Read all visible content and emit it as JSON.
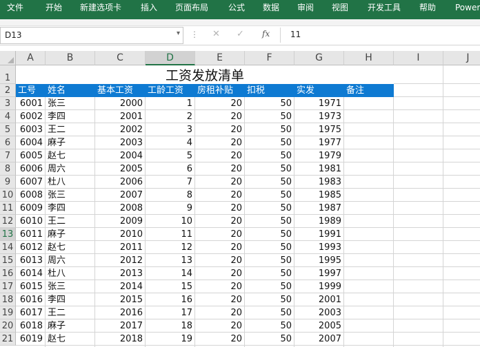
{
  "ribbon": {
    "bg": "#217346",
    "tabs": [
      "文件",
      "开始",
      "新建选项卡",
      "插入",
      "页面布局",
      "公式",
      "数据",
      "审阅",
      "视图",
      "开发工具",
      "帮助",
      "Power"
    ]
  },
  "formula_bar": {
    "name_box": "D13",
    "value": "11",
    "fx": "fx"
  },
  "columns": [
    "A",
    "B",
    "C",
    "D",
    "E",
    "F",
    "G",
    "H",
    "I",
    "J"
  ],
  "selected_column": "D",
  "selected_row": 13,
  "row_numbers": [
    "1",
    "2",
    "3",
    "4",
    "5",
    "6",
    "7",
    "8",
    "9",
    "10",
    "11",
    "12",
    "13",
    "14",
    "15",
    "16",
    "17",
    "18",
    "19",
    "20",
    "21"
  ],
  "sheet": {
    "title": "工资发放清单",
    "header_fill": "#0e7ad2",
    "headers": [
      "工号",
      "姓名",
      "基本工资",
      "工龄工资",
      "房租补贴",
      "扣税",
      "实发",
      "备注"
    ],
    "rows": [
      [
        "6001",
        "张三",
        "2000",
        "1",
        "20",
        "50",
        "1971"
      ],
      [
        "6002",
        "李四",
        "2001",
        "2",
        "20",
        "50",
        "1973"
      ],
      [
        "6003",
        "王二",
        "2002",
        "3",
        "20",
        "50",
        "1975"
      ],
      [
        "6004",
        "麻子",
        "2003",
        "4",
        "20",
        "50",
        "1977"
      ],
      [
        "6005",
        "赵七",
        "2004",
        "5",
        "20",
        "50",
        "1979"
      ],
      [
        "6006",
        "周六",
        "2005",
        "6",
        "20",
        "50",
        "1981"
      ],
      [
        "6007",
        "杜八",
        "2006",
        "7",
        "20",
        "50",
        "1983"
      ],
      [
        "6008",
        "张三",
        "2007",
        "8",
        "20",
        "50",
        "1985"
      ],
      [
        "6009",
        "李四",
        "2008",
        "9",
        "20",
        "50",
        "1987"
      ],
      [
        "6010",
        "王二",
        "2009",
        "10",
        "20",
        "50",
        "1989"
      ],
      [
        "6011",
        "麻子",
        "2010",
        "11",
        "20",
        "50",
        "1991"
      ],
      [
        "6012",
        "赵七",
        "2011",
        "12",
        "20",
        "50",
        "1993"
      ],
      [
        "6013",
        "周六",
        "2012",
        "13",
        "20",
        "50",
        "1995"
      ],
      [
        "6014",
        "杜八",
        "2013",
        "14",
        "20",
        "50",
        "1997"
      ],
      [
        "6015",
        "张三",
        "2014",
        "15",
        "20",
        "50",
        "1999"
      ],
      [
        "6016",
        "李四",
        "2015",
        "16",
        "20",
        "50",
        "2001"
      ],
      [
        "6017",
        "王二",
        "2016",
        "17",
        "20",
        "50",
        "2003"
      ],
      [
        "6018",
        "麻子",
        "2017",
        "18",
        "20",
        "50",
        "2005"
      ],
      [
        "6019",
        "赵七",
        "2018",
        "19",
        "20",
        "50",
        "2007"
      ]
    ]
  }
}
